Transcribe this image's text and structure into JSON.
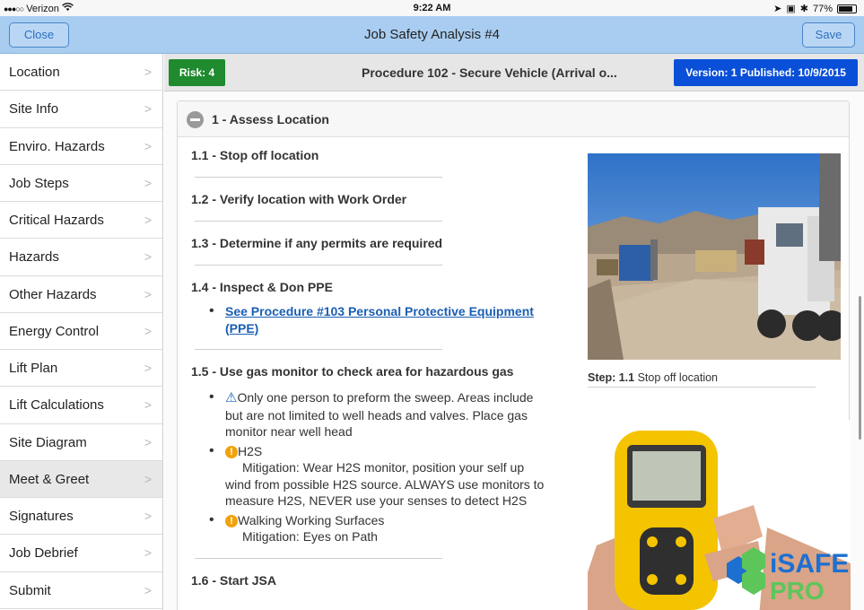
{
  "status_bar": {
    "carrier": "Verizon",
    "time": "9:22 AM",
    "battery": "77%"
  },
  "nav": {
    "title": "Job Safety Analysis #4",
    "close_label": "Close",
    "save_label": "Save"
  },
  "sidebar": {
    "items": [
      {
        "label": "Location"
      },
      {
        "label": "Site Info"
      },
      {
        "label": "Enviro. Hazards"
      },
      {
        "label": "Job Steps"
      },
      {
        "label": "Critical Hazards"
      },
      {
        "label": "Hazards"
      },
      {
        "label": "Other Hazards"
      },
      {
        "label": "Energy Control"
      },
      {
        "label": "Lift Plan"
      },
      {
        "label": "Lift Calculations"
      },
      {
        "label": "Site Diagram"
      },
      {
        "label": "Meet & Greet"
      },
      {
        "label": "Signatures"
      },
      {
        "label": "Job Debrief"
      },
      {
        "label": "Submit"
      }
    ],
    "active_index": 11
  },
  "header": {
    "risk": "Risk: 4",
    "procedure_title": "Procedure 102 - Secure Vehicle (Arrival o...",
    "version": "Version: 1 Published: 10/9/2015"
  },
  "panel": {
    "title": "1 - Assess Location",
    "steps": {
      "s1": "1.1 - Stop off location",
      "s2": "1.2 - Verify location with Work Order",
      "s3": "1.3 - Determine if any permits are required",
      "s4": "1.4 - Inspect & Don PPE",
      "s4_link_a": "See Procedure #103 Personal Protective Equipment",
      "s4_link_b": "(PPE)",
      "s5": "1.5 - Use gas monitor to check area for hazardous gas",
      "s5_b1_a": "Only one person to preform the sweep. Areas include",
      "s5_b1_b": "but are not limited to well heads and valves. Place gas",
      "s5_b1_c": "monitor near well head",
      "s5_b2_title": "H2S",
      "s5_b2_a": "Mitigation: Wear H2S monitor, position your self up",
      "s5_b2_b": "wind from possible H2S source. ALWAYS use monitors to",
      "s5_b2_c": "measure H2S, NEVER use your senses to detect H2S",
      "s5_b3_title": "Walking Working Surfaces",
      "s5_b3_a": "Mitigation: Eyes on Path",
      "s6": "1.6 - Start JSA"
    },
    "caption_step": "Step: 1.1",
    "caption_text": "Stop off location"
  },
  "branding": {
    "logo_top": "iSAFE",
    "logo_bottom": "PRO"
  }
}
